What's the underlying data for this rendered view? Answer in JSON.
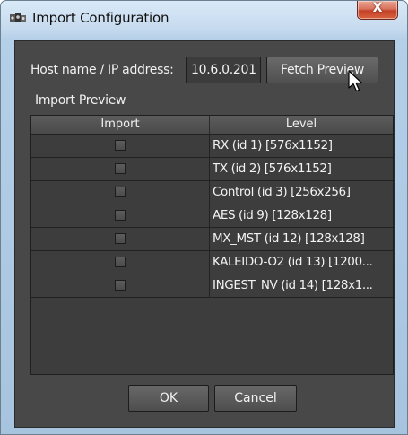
{
  "window": {
    "title": "Import Configuration",
    "close_label": "X"
  },
  "host": {
    "label": "Host name / IP address:",
    "value": "10.6.0.201",
    "fetch_label": "Fetch Preview"
  },
  "preview": {
    "label": "Import Preview",
    "columns": [
      "Import",
      "Level"
    ],
    "rows": [
      {
        "checked": false,
        "level": "RX (id 1) [576x1152]"
      },
      {
        "checked": false,
        "level": "TX (id 2) [576x1152]"
      },
      {
        "checked": false,
        "level": "Control (id 3) [256x256]"
      },
      {
        "checked": false,
        "level": "AES (id 9) [128x128]"
      },
      {
        "checked": false,
        "level": "MX_MST (id 12) [128x128]"
      },
      {
        "checked": false,
        "level": "KALEIDO-O2 (id 13) [1200..."
      },
      {
        "checked": false,
        "level": "INGEST_NV (id 14) [128x1..."
      }
    ]
  },
  "buttons": {
    "ok": "OK",
    "cancel": "Cancel"
  }
}
